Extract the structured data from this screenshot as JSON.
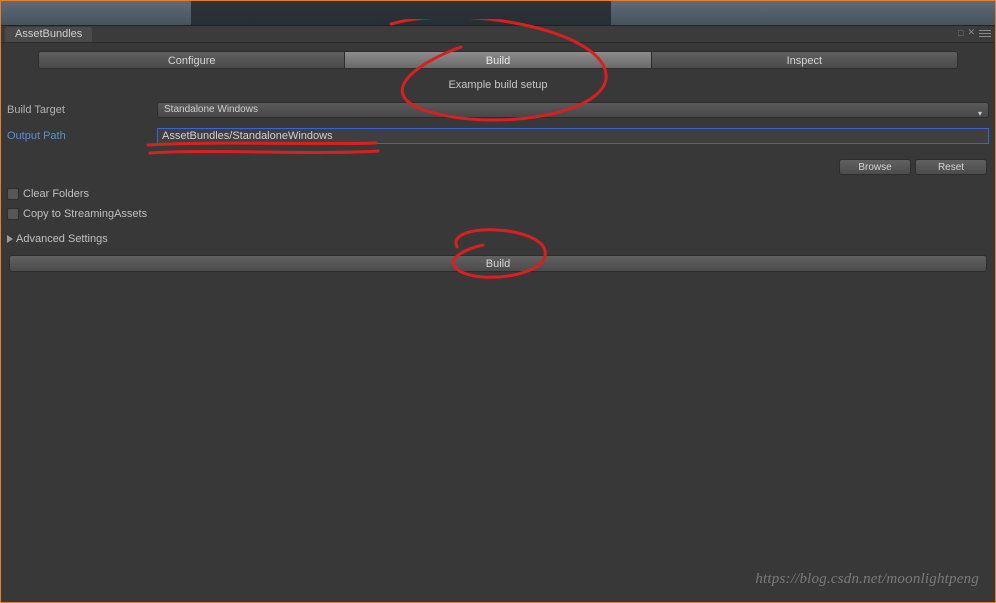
{
  "window": {
    "tab_title": "AssetBundles"
  },
  "tabs": {
    "configure": "Configure",
    "build": "Build",
    "inspect": "Inspect"
  },
  "subtitle": "Example build setup",
  "fields": {
    "build_target_label": "Build Target",
    "build_target_value": "Standalone Windows",
    "output_path_label": "Output Path",
    "output_path_value": "AssetBundles/StandaloneWindows"
  },
  "buttons": {
    "browse": "Browse",
    "reset": "Reset",
    "build": "Build"
  },
  "checks": {
    "clear_folders": "Clear Folders",
    "copy_streaming": "Copy to StreamingAssets"
  },
  "foldout": {
    "advanced": "Advanced Settings"
  },
  "watermark": "https://blog.csdn.net/moonlightpeng"
}
